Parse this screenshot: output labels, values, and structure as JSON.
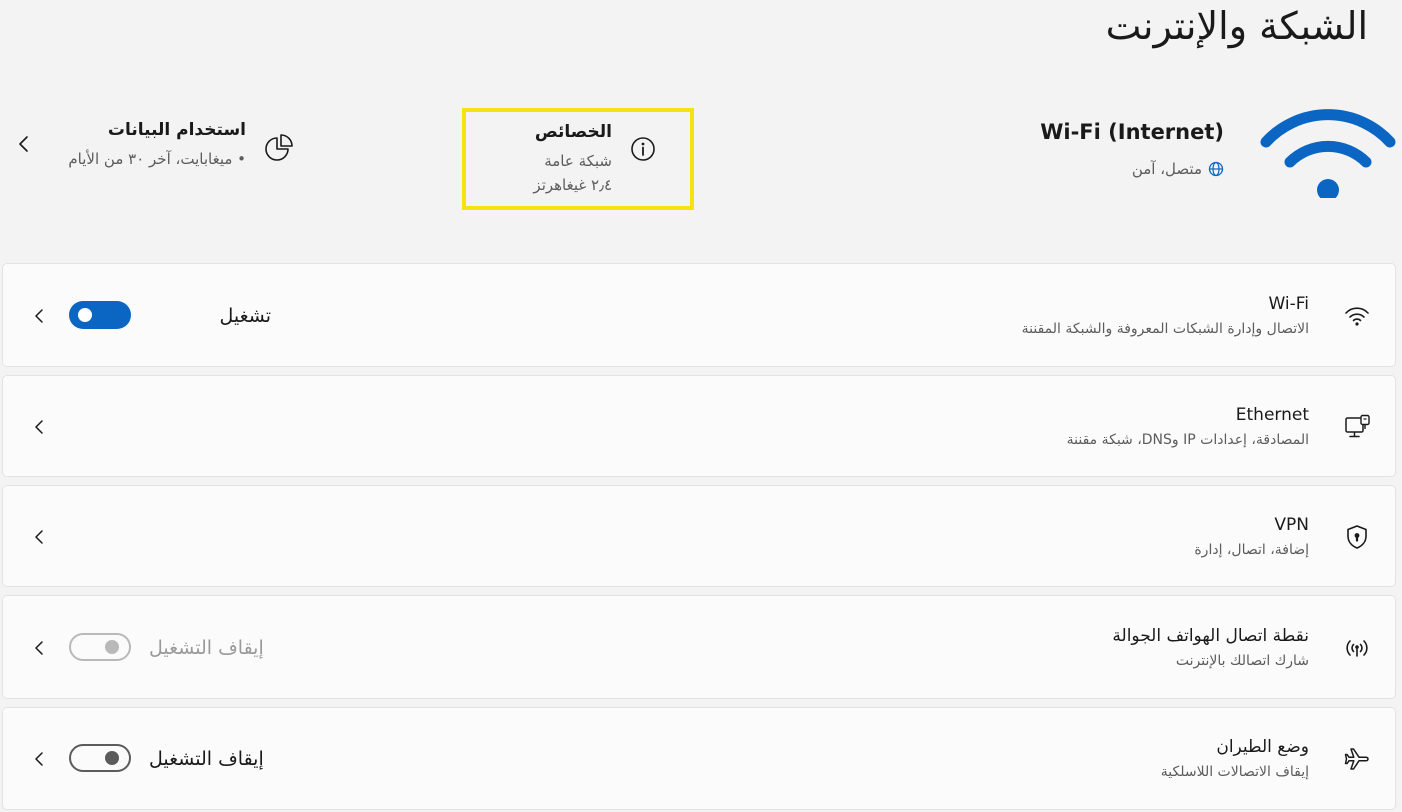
{
  "page": {
    "title": "الشبكة والإنترنت"
  },
  "header": {
    "network_name": "Wi-Fi (Internet)",
    "network_status": "متصل، آمن",
    "properties": {
      "title": "الخصائص",
      "line1": "شبكة عامة",
      "line2": "٢٫٤ غيغاهرتز"
    },
    "data_usage": {
      "title": "استخدام البيانات",
      "subtitle": "• ميغابايت، آخر ٣٠ من الأيام"
    }
  },
  "rows": [
    {
      "icon": "wifi-icon",
      "title": "Wi-Fi",
      "subtitle": "الاتصال وإدارة الشبكات المعروفة والشبكة المقننة",
      "toggle_label": "تشغيل",
      "toggle_state": "on"
    },
    {
      "icon": "ethernet-icon",
      "title": "Ethernet",
      "subtitle": "المصادقة، إعدادات IP وDNS، شبكة مقننة"
    },
    {
      "icon": "vpn-shield-icon",
      "title": "VPN",
      "subtitle": "إضافة، اتصال، إدارة"
    },
    {
      "icon": "hotspot-icon",
      "title": "نقطة اتصال الهواتف الجوالة",
      "subtitle": "شارك اتصالك بالإنترنت",
      "toggle_label": "إيقاف التشغيل",
      "toggle_state": "off-disabled"
    },
    {
      "icon": "airplane-icon",
      "title": "وضع الطيران",
      "subtitle": "إيقاف الاتصالات اللاسلكية",
      "toggle_label": "إيقاف التشغيل",
      "toggle_state": "off"
    }
  ],
  "colors": {
    "accent": "#0a66c2",
    "highlight_border": "#f5e311",
    "background": "#f3f3f3",
    "card": "#fbfbfb"
  }
}
